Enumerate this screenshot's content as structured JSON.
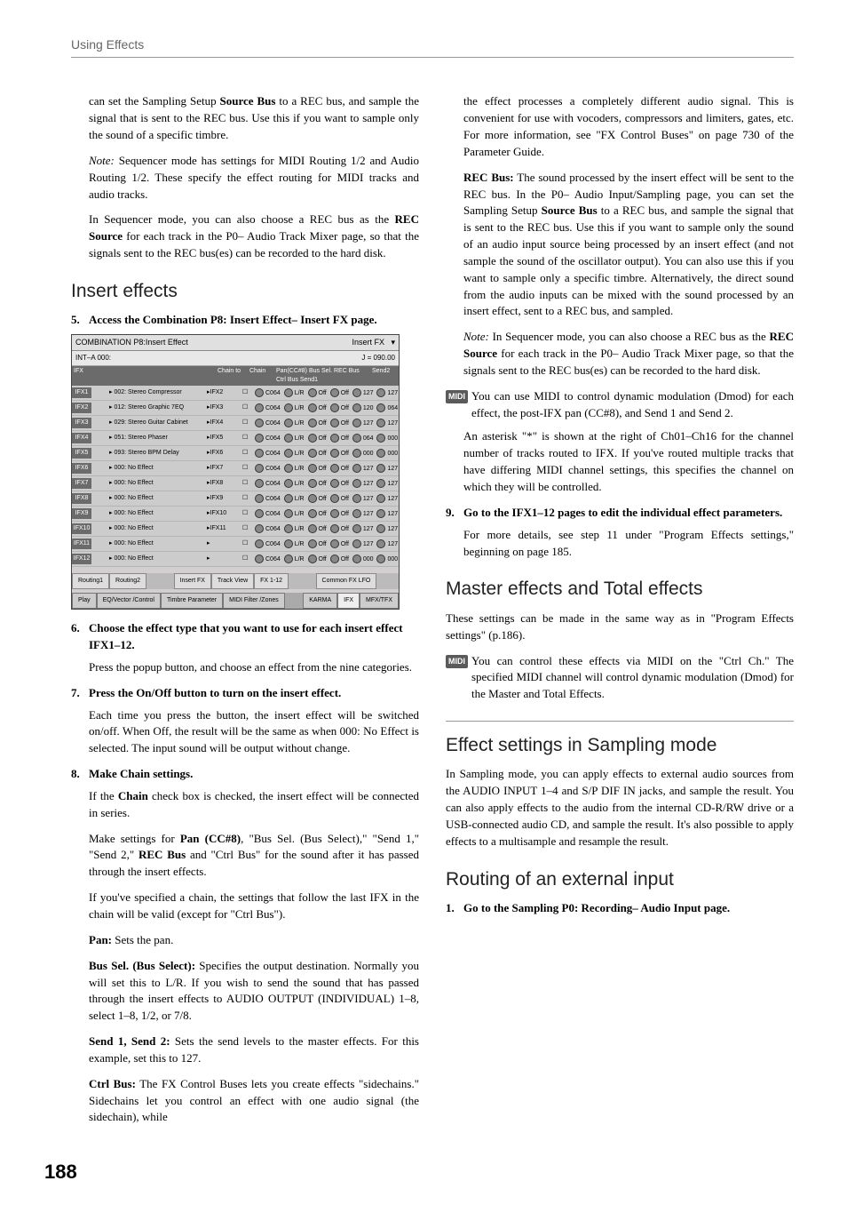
{
  "runningHead": "Using Effects",
  "pageNumber": "188",
  "left": {
    "p1": "can set the Sampling Setup Source Bus to a REC bus, and sample the signal that is sent to the REC bus. Use this if you want to sample only the sound of a specific timbre.",
    "p1_bold": "Source Bus",
    "p2a": "Note:",
    "p2b": " Sequencer mode has settings for MIDI Routing 1/2 and Audio Routing 1/2. These specify the effect routing for MIDI tracks and audio tracks.",
    "p3": "In Sequencer mode, you can also choose a REC bus as the REC Source for each track in the P0– Audio Track Mixer page, so that the signals sent to the REC bus(es) can be recorded to the hard disk.",
    "p3_bold": "REC Source",
    "h_insert": "Insert effects",
    "step5": "Access the Combination P8: Insert Effect– Insert FX page.",
    "step6": "Choose the effect type that you want to use for each insert effect IFX1–12.",
    "p6a": "Press the popup button, and choose an effect from the nine categories.",
    "step7": "Press the On/Off button to turn on the insert effect.",
    "p7a": "Each time you press the button, the insert effect will be switched on/off. When Off, the result will be the same as when 000: No Effect is selected. The input sound will be output without change.",
    "step8": "Make Chain settings.",
    "p8a_a": "If the ",
    "p8a_bold": "Chain",
    "p8a_b": " check box is checked, the insert effect will be connected in series.",
    "p8b_a": "Make settings for ",
    "p8b_b1": "Pan (CC#8)",
    "p8b_b": ", \"Bus Sel. (Bus Select),\" \"Send 1,\" \"Send 2,\" ",
    "p8b_b2": "REC Bus",
    "p8b_c": " and \"Ctrl Bus\" for the sound after it has passed through the insert effects.",
    "p8c": "If you've specified a chain, the settings that follow the last IFX in the chain will be valid (except for \"Ctrl Bus\").",
    "p8d_b": "Pan:",
    "p8d": " Sets the pan.",
    "p8e_b": "Bus Sel. (Bus Select):",
    "p8e": " Specifies the output destination. Normally you will set this to L/R. If you wish to send the sound that has passed through the insert effects to AUDIO OUTPUT (INDIVIDUAL) 1–8, select 1–8, 1/2, or 7/8.",
    "p8f_b": "Send 1, Send 2:",
    "p8f": " Sets the send levels to the master effects. For this example, set this to 127.",
    "p8g_b": "Ctrl Bus:",
    "p8g": " The FX Control Buses lets you create effects \"sidechains.\" Sidechains let you control an effect with one audio signal (the sidechain), while"
  },
  "screenshot": {
    "title": "COMBINATION P8:Insert Effect",
    "titleRight": "Insert FX",
    "sub_left": "INT–A    000:",
    "sub_right_tempo": "J = 090.00",
    "head": [
      "IFX",
      "",
      "",
      "Chain to",
      "Chain",
      "Pan(CC#8)  Bus Sel.  REC Bus Ctrl Bus  Send1",
      "Send2"
    ],
    "rows": [
      {
        "ifx": "IFX1",
        "on": true,
        "name": "002: Stereo Compressor",
        "chain": "IFX2",
        "vals": "C064  L/R  Off  Off  127  127"
      },
      {
        "ifx": "IFX2",
        "on": true,
        "name": "012: Stereo Graphic 7EQ",
        "chain": "IFX3",
        "vals": "C064  L/R  Off  Off  120  064"
      },
      {
        "ifx": "IFX3",
        "on": true,
        "name": "029: Stereo Guitar Cabinet",
        "chain": "IFX4",
        "vals": "C064  L/R  Off  Off  127  127"
      },
      {
        "ifx": "IFX4",
        "on": true,
        "name": "051: Stereo Phaser",
        "chain": "IFX5",
        "vals": "C064  L/R  Off  Off  064  000"
      },
      {
        "ifx": "IFX5",
        "on": true,
        "name": "093: Stereo BPM Delay",
        "chain": "IFX6",
        "vals": "C064  L/R  Off  Off  000  000"
      },
      {
        "ifx": "IFX6",
        "on": false,
        "name": "000: No Effect",
        "chain": "IFX7",
        "vals": "C064  L/R  Off  Off  127  127"
      },
      {
        "ifx": "IFX7",
        "on": false,
        "name": "000: No Effect",
        "chain": "IFX8",
        "vals": "C064  L/R  Off  Off  127  127"
      },
      {
        "ifx": "IFX8",
        "on": false,
        "name": "000: No Effect",
        "chain": "IFX9",
        "vals": "C064  L/R  Off  Off  127  127"
      },
      {
        "ifx": "IFX9",
        "on": false,
        "name": "000: No Effect",
        "chain": "IFX10",
        "vals": "C064  L/R  Off  Off  127  127"
      },
      {
        "ifx": "IFX10",
        "on": false,
        "name": "000: No Effect",
        "chain": "IFX11",
        "vals": "C064  L/R  Off  Off  127  127"
      },
      {
        "ifx": "IFX11",
        "on": false,
        "name": "000: No Effect",
        "chain": "",
        "vals": "C064  L/R  Off  Off  127  127"
      },
      {
        "ifx": "IFX12",
        "on": false,
        "name": "000: No Effect",
        "chain": "",
        "vals": "C064  L/R  Off  Off  000  000"
      }
    ],
    "tabs1": [
      "Routing1",
      "Routing2",
      "",
      "Insert FX",
      "Track View",
      "FX 1-12",
      "",
      "Common FX LFO"
    ],
    "tabs2": [
      "Play",
      "EQ/Vector /Control",
      "Timbre Parameter",
      "MIDI Filter /Zones",
      "",
      "KARMA",
      "IFX",
      "MFX/TFX"
    ]
  },
  "right": {
    "p1": "the effect processes a completely different audio signal. This is convenient for use with vocoders, compressors and limiters, gates, etc. For more information, see \"FX Control Buses\" on page 730 of the Parameter Guide.",
    "p2_b": "REC Bus:",
    "p2": " The sound processed by the insert effect will be sent to the REC bus. In the P0– Audio Input/Sampling page, you can set the Sampling Setup Source Bus to a REC bus, and sample the signal that is sent to the REC bus. Use this if you want to sample only the sound of an audio input source being processed by an insert effect (and not sample the sound of the oscillator output). You can also use this if you want to sample only a specific timbre. Alternatively, the direct sound from the audio inputs can be mixed with the sound processed by an insert effect, sent to a REC bus, and sampled.",
    "p2_bold2": "Source Bus",
    "p3a": "Note:",
    "p3b": " In Sequencer mode, you can also choose a REC bus as the REC Source for each track in the P0– Audio Track Mixer page, so that the signals sent to the REC bus(es) can be recorded to the hard disk.",
    "p3_bold": "REC Source",
    "midiLabel": "MIDI",
    "midi1": "You can use MIDI to control dynamic modulation (Dmod) for each effect, the post-IFX pan (CC#8), and Send 1 and Send 2.",
    "p4": "An asterisk \"*\" is shown at the right of Ch01–Ch16 for the channel number of tracks routed to IFX. If you've routed multiple tracks that have differing MIDI channel settings, this specifies the channel on which they will be controlled.",
    "step9": "Go to the IFX1–12 pages to edit the individual effect parameters.",
    "p9a": "For more details, see step 11 under \"Program Effects settings,\" beginning on page 185.",
    "h_master": "Master effects and Total effects",
    "pm1": "These settings can be made in the same way as in \"Program Effects settings\" (p.186).",
    "midi2": "You can control these effects via MIDI on the \"Ctrl Ch.\" The specified MIDI channel will control dynamic modulation (Dmod) for the Master and Total Effects.",
    "h_sampling": "Effect settings in Sampling mode",
    "ps1": "In Sampling mode, you can apply effects to external audio sources from the AUDIO INPUT 1–4 and S/P DIF IN jacks, and sample the result. You can also apply effects to the audio from the internal CD-R/RW drive or a USB-connected audio CD, and sample the result. It's also possible to apply effects to a multisample and resample the result.",
    "h_routing": "Routing of an external input",
    "step1": "Go to the Sampling P0: Recording– Audio Input page."
  }
}
